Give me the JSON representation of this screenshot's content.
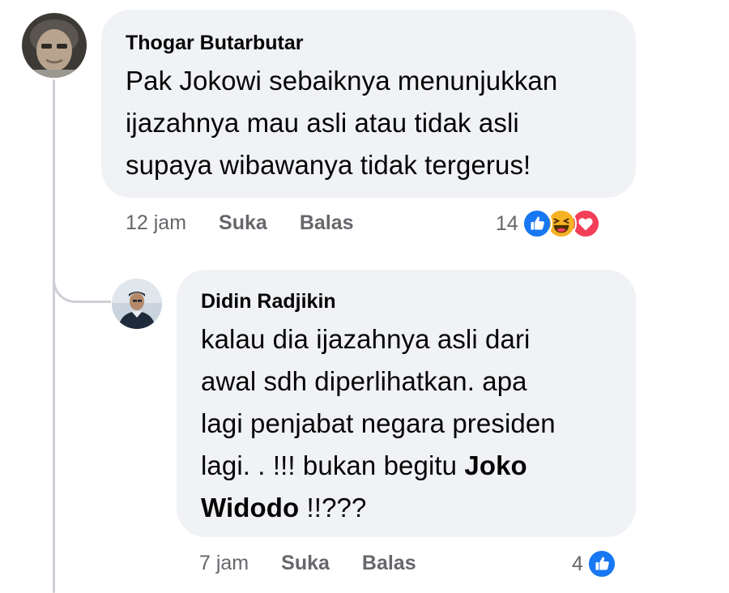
{
  "comments": [
    {
      "author": "Thogar Butarbutar",
      "text_lines": [
        "Pak Jokowi sebaiknya menunjukkan",
        "ijazahnya mau asli atau tidak asli",
        "supaya wibawanya tidak tergerus!"
      ],
      "time": "12 jam",
      "like_label": "Suka",
      "reply_label": "Balas",
      "reaction_count": "14",
      "reactions": [
        "like-icon",
        "haha-icon",
        "love-icon"
      ]
    },
    {
      "author": "Didin Radjikin",
      "text_lines": [
        "kalau dia ijazahnya asli dari",
        "awal sdh diperlihatkan. apa",
        "lagi penjabat negara presiden"
      ],
      "line4_prefix": "lagi. . !!! bukan begitu ",
      "mention_part1": "Joko",
      "mention_part2": "Widodo",
      "line5_suffix": " !!???",
      "time": "7 jam",
      "like_label": "Suka",
      "reply_label": "Balas",
      "reaction_count": "4",
      "reactions": [
        "like-icon"
      ]
    }
  ],
  "colors": {
    "bubble_bg": "#f0f2f5",
    "meta_text": "#65676b",
    "like_blue": "#1877f2",
    "love_red": "#f33e58",
    "haha_yellow": "#f7b125"
  }
}
